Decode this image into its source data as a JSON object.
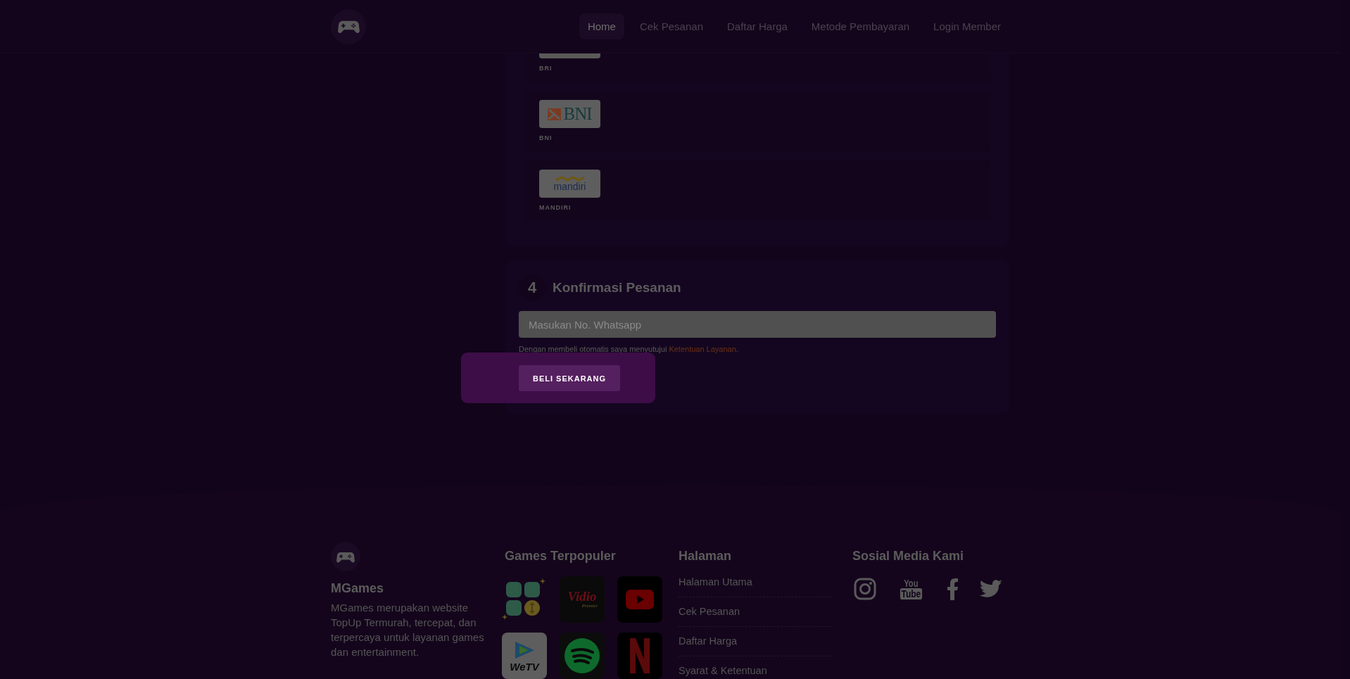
{
  "header": {
    "nav": [
      {
        "label": "Home",
        "selected": true
      },
      {
        "label": "Cek Pesanan",
        "selected": false
      },
      {
        "label": "Daftar Harga",
        "selected": false
      },
      {
        "label": "Metode Pembayaran",
        "selected": false
      },
      {
        "label": "Login Member",
        "selected": false
      }
    ]
  },
  "payment_methods": [
    {
      "kind": "bri",
      "label": "BRI"
    },
    {
      "kind": "bni",
      "label": "BNI",
      "logo_text": "BNI"
    },
    {
      "kind": "mandiri",
      "label": "MANDIRI",
      "logo_text": "mandiri"
    }
  ],
  "confirmation": {
    "step": "4",
    "title": "Konfirmasi Pesanan",
    "whatsapp": {
      "placeholder": "Masukan No. Whatsapp"
    },
    "terms": "Dengan membeli otomatis saya menyutujui ",
    "terms_link": "Ketentuan Layanan",
    "terms_end": ".",
    "button": "BELI SEKARANG"
  },
  "footer": {
    "brand": "MGames",
    "description": "MGames merupakan website TopUp Termurah, tercepat, dan terpercaya untuk layanan games dan entertainment.",
    "games_title": "Games Terpopuler",
    "games": [
      {
        "kind": "topup"
      },
      {
        "kind": "vidio",
        "logo_text": "Vidio",
        "sub_text": "Premier"
      },
      {
        "kind": "youtube"
      },
      {
        "kind": "wetv",
        "logo_text": "WeTV"
      },
      {
        "kind": "spotify"
      },
      {
        "kind": "netflix"
      }
    ],
    "pages_title": "Halaman",
    "pages": [
      "Halaman Utama",
      "Cek Pesanan",
      "Daftar Harga",
      "Syarat & Ketentuan"
    ],
    "social_title": "Sosial Media Kami",
    "social": [
      {
        "kind": "instagram"
      },
      {
        "kind": "youtube",
        "texts": [
          "You",
          "Tube"
        ]
      },
      {
        "kind": "facebook"
      },
      {
        "kind": "twitter"
      }
    ]
  }
}
